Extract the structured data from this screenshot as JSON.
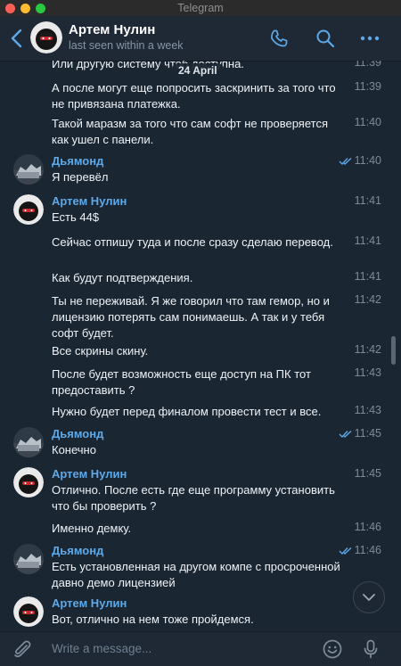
{
  "window": {
    "title": "Telegram"
  },
  "header": {
    "name": "Артем Нулин",
    "status": "last seen within a week"
  },
  "date_separator": "24 April",
  "messages": [
    {
      "type": "cont",
      "text": "Или другую систему чтоб доступна.",
      "time": "11:39"
    },
    {
      "type": "cont",
      "text": "А после могут еще попросить заскринить за того что не привязана платежка.",
      "time": "11:39"
    },
    {
      "type": "cont",
      "text": "Такой маразм за того что сам софт не проверяется как ушел с панели.",
      "time": "11:40"
    },
    {
      "type": "head",
      "sender": "Дьямонд",
      "text": "Я перевёл",
      "time": "11:40",
      "read": true,
      "avatar": "diamond"
    },
    {
      "type": "head",
      "sender": "Артем Нулин",
      "text": "Есть 44$",
      "time": "11:41",
      "read": false,
      "avatar": "artem"
    },
    {
      "type": "cont",
      "text": "Сейчас отпишу туда и после сразу сделаю перевод.",
      "time": "11:41"
    },
    {
      "type": "cont",
      "text": "Как будут подтверждения.",
      "time": "11:41"
    },
    {
      "type": "cont",
      "text": "Ты не переживай. Я же говорил что там гемор, но и лицензию потерять сам понимаешь. А так и у тебя софт будет.",
      "time": "11:42"
    },
    {
      "type": "cont",
      "text": "Все скрины скину.",
      "time": "11:42"
    },
    {
      "type": "cont",
      "text": "После будет возможность еще доступ на ПК тот предоставить ?",
      "time": "11:43"
    },
    {
      "type": "cont",
      "text": "Нужно будет перед финалом провести тест и все.",
      "time": "11:43"
    },
    {
      "type": "head",
      "sender": "Дьямонд",
      "text": "Конечно",
      "time": "11:45",
      "read": true,
      "avatar": "diamond"
    },
    {
      "type": "head",
      "sender": "Артем Нулин",
      "text": "Отлично. После есть где еще программу установить что бы проверить ?",
      "time": "11:45",
      "read": false,
      "avatar": "artem"
    },
    {
      "type": "cont",
      "text": "Именно демку.",
      "time": "11:46"
    },
    {
      "type": "head",
      "sender": "Дьямонд",
      "text": "Есть установленная на другом компе с просроченной давно демо лицензией",
      "time": "11:46",
      "read": true,
      "avatar": "diamond"
    },
    {
      "type": "head",
      "sender": "Артем Нулин",
      "text": "Вот, отлично на нем тоже пройдемся.",
      "time": "",
      "read": false,
      "avatar": "artem"
    }
  ],
  "composer": {
    "placeholder": "Write a message..."
  },
  "colors": {
    "accent": "#5ea9e8",
    "background": "#1b2633",
    "header": "#1f2936"
  },
  "icons": [
    "back-chevron-icon",
    "phone-icon",
    "search-icon",
    "more-icon",
    "attach-icon",
    "emoji-icon",
    "microphone-icon",
    "read-check-icon",
    "chevron-down-icon"
  ]
}
